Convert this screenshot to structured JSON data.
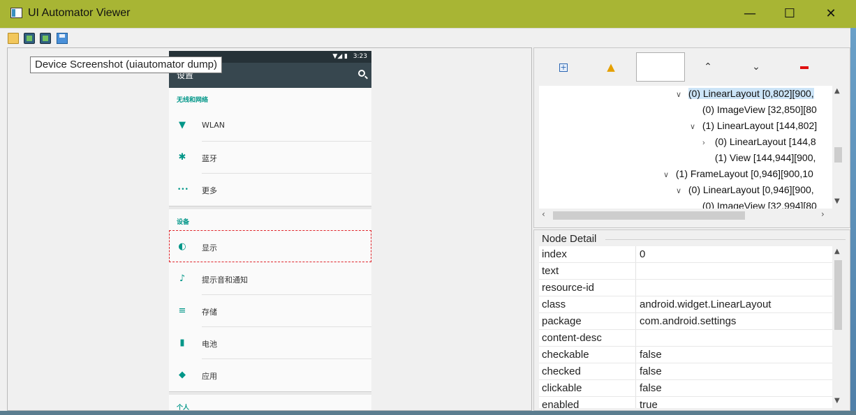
{
  "window": {
    "title": "UI Automator Viewer",
    "minimize": "—",
    "maximize": "☐",
    "close": "✕"
  },
  "toolbar": {
    "open_icon": "folder-open-icon",
    "device_screenshot_icon": "device-screenshot-icon",
    "device_screenshot_compressed_icon": "device-screenshot-compressed-icon",
    "save_icon": "save-icon"
  },
  "tooltip": "Device Screenshot (uiautomator dump)",
  "phone": {
    "time": "3:23",
    "signal": "▼◢ ▮",
    "app_title": "设置",
    "sections": [
      {
        "header": "无线和网络"
      },
      {
        "header": "设备"
      },
      {
        "header": "个人"
      }
    ],
    "items": [
      {
        "label": "WLAN",
        "icon": "▼"
      },
      {
        "label": "蓝牙",
        "icon": "✱"
      },
      {
        "label": "更多",
        "icon": "•••"
      },
      {
        "label": "显示",
        "icon": "◐"
      },
      {
        "label": "提示音和通知",
        "icon": "♪"
      },
      {
        "label": "存储",
        "icon": "≡"
      },
      {
        "label": "电池",
        "icon": "▮"
      },
      {
        "label": "应用",
        "icon": "◆"
      }
    ]
  },
  "tree": {
    "rows": [
      {
        "label": "(0) LinearLayout [0,802][900,",
        "arrow": "∨"
      },
      {
        "label": "(0) ImageView [32,850][80",
        "arrow": ""
      },
      {
        "label": "(1) LinearLayout [144,802]",
        "arrow": "∨"
      },
      {
        "label": "(0) LinearLayout [144,8",
        "arrow": "›"
      },
      {
        "label": "(1) View [144,944][900,",
        "arrow": ""
      },
      {
        "label": "(1) FrameLayout [0,946][900,10",
        "arrow": "∨"
      },
      {
        "label": "(0) LinearLayout [0,946][900,",
        "arrow": "∨"
      },
      {
        "label": "(0) ImageView [32,994][80",
        "arrow": ""
      }
    ]
  },
  "node_detail": {
    "title": "Node Detail",
    "rows": [
      {
        "key": "index",
        "value": "0"
      },
      {
        "key": "text",
        "value": ""
      },
      {
        "key": "resource-id",
        "value": ""
      },
      {
        "key": "class",
        "value": "android.widget.LinearLayout"
      },
      {
        "key": "package",
        "value": "com.android.settings"
      },
      {
        "key": "content-desc",
        "value": ""
      },
      {
        "key": "checkable",
        "value": "false"
      },
      {
        "key": "checked",
        "value": "false"
      },
      {
        "key": "clickable",
        "value": "false"
      },
      {
        "key": "enabled",
        "value": "true"
      }
    ]
  }
}
